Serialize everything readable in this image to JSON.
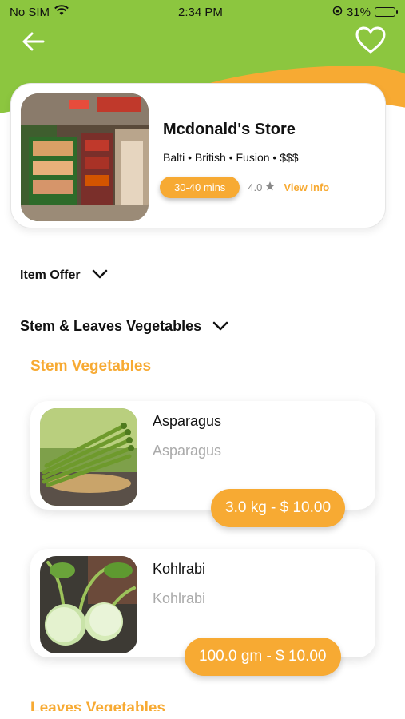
{
  "status_bar": {
    "carrier": "No SIM",
    "time": "2:34 PM",
    "battery": "31%"
  },
  "icons": {
    "back": "arrow-left-icon",
    "favorite": "heart-icon"
  },
  "colors": {
    "brand_green": "#8cc63f",
    "accent_orange": "#f7aa33"
  },
  "store": {
    "name": "Mcdonald's Store",
    "tags": "Balti • British • Fusion • $$$",
    "delivery_time": "30-40 mins",
    "rating": "4.0",
    "view_info": "View Info"
  },
  "sections": {
    "item_offer": "Item Offer",
    "category": "Stem & Leaves Vegetables",
    "subcategory_1": "Stem Vegetables",
    "subcategory_2": "Leaves Vegetables"
  },
  "products": [
    {
      "name": "Asparagus",
      "subtitle": "Asparagus",
      "price": "3.0 kg - $ 10.00"
    },
    {
      "name": "Kohlrabi",
      "subtitle": "Kohlrabi",
      "price": "100.0 gm - $ 10.00"
    }
  ]
}
